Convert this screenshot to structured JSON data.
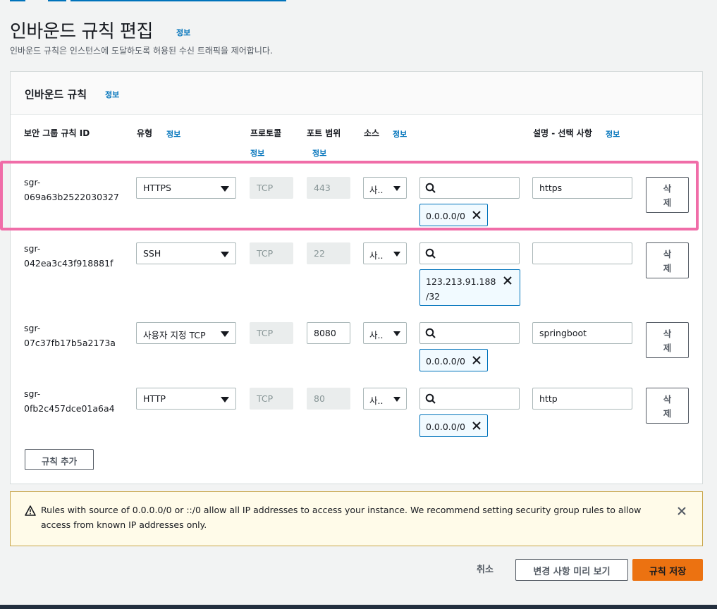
{
  "colors": {
    "link": "#0073bb",
    "primary": "#ec7211",
    "highlight": "#f06da8",
    "token_border": "#0073bb"
  },
  "page": {
    "title": "인바운드 규칙 편집",
    "title_info": "정보",
    "description": "인바운드 규칙은 인스턴스에 도달하도록 허용된 수신 트래픽을 제어합니다."
  },
  "panel": {
    "title": "인바운드 규칙",
    "title_info": "정보",
    "columns": {
      "rule_id": "보안 그룹 규칙 ID",
      "type": "유형",
      "type_info": "정보",
      "protocol": "프로토콜",
      "protocol_info": "정보",
      "port": "포트 범위",
      "port_info": "정보",
      "source": "소스",
      "source_info": "정보",
      "desc": "설명 - 선택 사항",
      "desc_info": "정보"
    },
    "rows": [
      {
        "id_1": "sgr-",
        "id_2": "069a63b2522030327",
        "type": "HTTPS",
        "protocol": "TCP",
        "port": "443",
        "source_type": "사..",
        "tokens": [
          "0.0.0.0/0"
        ],
        "description": "https",
        "delete_1": "삭",
        "delete_2": "제"
      },
      {
        "id_1": "sgr-",
        "id_2": "042ea3c43f918881f",
        "type": "SSH",
        "protocol": "TCP",
        "port": "22",
        "source_type": "사..",
        "tokens": [
          "123.213.91.188",
          "/32"
        ],
        "description": "",
        "delete_1": "삭",
        "delete_2": "제"
      },
      {
        "id_1": "sgr-",
        "id_2": "07c37fb17b5a2173a",
        "type": "사용자 지정 TCP",
        "protocol": "TCP",
        "port": "8080",
        "source_type": "사..",
        "tokens": [
          "0.0.0.0/0"
        ],
        "description": "springboot",
        "delete_1": "삭",
        "delete_2": "제"
      },
      {
        "id_1": "sgr-",
        "id_2": "0fb2c457dce01a6a4",
        "type": "HTTP",
        "protocol": "TCP",
        "port": "80",
        "source_type": "사..",
        "tokens": [
          "0.0.0.0/0"
        ],
        "description": "http",
        "delete_1": "삭",
        "delete_2": "제"
      }
    ],
    "add_rule": "규칙 추가"
  },
  "warning": {
    "text": "Rules with source of 0.0.0.0/0 or ::/0 allow all IP addresses to access your instance. We recommend setting security group rules to allow access from known IP addresses only.",
    "icon": "warning-icon"
  },
  "footer": {
    "cancel": "취소",
    "preview": "변경 사항 미리 보기",
    "save": "규칙 저장"
  }
}
